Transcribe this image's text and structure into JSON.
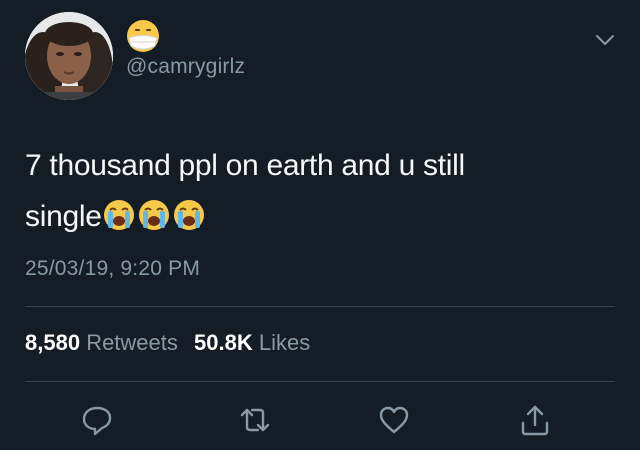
{
  "author": {
    "handle": "@camrygirlz",
    "avatar_icon": "user-avatar",
    "display_name_icon": "face-with-medical-mask-emoji"
  },
  "tweet": {
    "text_line1": "7 thousand ppl on earth and u still",
    "text_line2": "single",
    "trailing_emojis": [
      "loudly-crying-face-emoji",
      "loudly-crying-face-emoji",
      "loudly-crying-face-emoji"
    ],
    "timestamp": "25/03/19, 9:20 PM"
  },
  "stats": {
    "retweets_count": "8,580",
    "retweets_label": "Retweets",
    "likes_count": "50.8K",
    "likes_label": "Likes"
  },
  "actions": [
    {
      "name": "reply",
      "icon": "reply-icon"
    },
    {
      "name": "retweet",
      "icon": "retweet-icon"
    },
    {
      "name": "like",
      "icon": "heart-icon"
    },
    {
      "name": "share",
      "icon": "share-icon"
    }
  ],
  "colors": {
    "background": "#141d26",
    "text": "#f5f8fa",
    "secondary": "#8899a6",
    "divider": "#38444d"
  }
}
